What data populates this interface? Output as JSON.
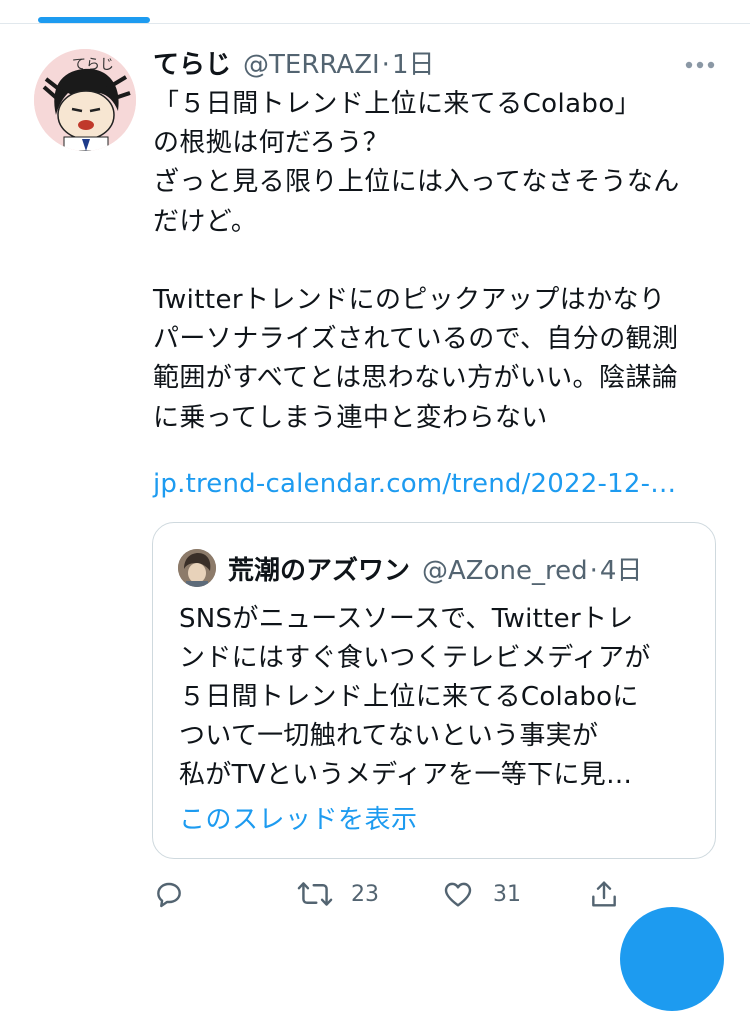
{
  "tweet": {
    "display_name": "てらじ",
    "handle": "@TERRAZI",
    "separator": "·",
    "time": "1日",
    "lines": [
      "「５日間トレンド上位に来てるColabo」",
      "の根拠は何だろう？",
      "ざっと見る限り上位には入ってなさそうなん",
      "だけど。",
      "",
      "Twitterトレンドにのピックアップはかなり",
      "パーソナライズされているので、自分の観測",
      "範囲がすべてとは思わない方がいい。陰謀論",
      "に乗ってしまう連中と変わらない",
      ""
    ],
    "link": "jp.trend-calendar.com/trend/2022-12-…",
    "avatar_text": "てらじ"
  },
  "quote": {
    "display_name": "荒潮のアズワン",
    "handle": "@AZone_red",
    "separator": "·",
    "time": "4日",
    "lines": [
      "SNSがニュースソースで、Twitterトレ",
      "ンドにはすぐ食いつくテレビメディアが",
      "５日間トレンド上位に来てるColaboに",
      "ついて一切触れてないという事実が",
      "私がTVというメディアを一等下に見…"
    ],
    "show_thread": "このスレッドを表示"
  },
  "actions": {
    "reply_icon": "reply-icon",
    "retweet_icon": "retweet-icon",
    "retweet_count": "23",
    "like_icon": "heart-icon",
    "like_count": "31",
    "share_icon": "share-icon"
  },
  "colors": {
    "accent": "#1d9bf0",
    "secondary_text": "#536471",
    "primary_text": "#0f1419",
    "border": "#cfd9de"
  }
}
